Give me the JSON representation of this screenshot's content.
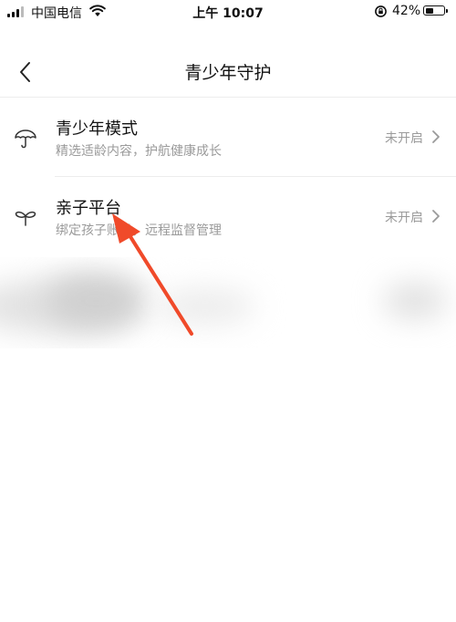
{
  "status_bar": {
    "carrier": "中国电信",
    "time": "上午 10:07",
    "battery_percent_label": "42%",
    "battery_level": 0.42,
    "icons": [
      "signal-icon",
      "wifi-icon",
      "rotation-lock-icon",
      "battery-icon"
    ]
  },
  "nav": {
    "title": "青少年守护",
    "back_icon": "chevron-left-icon"
  },
  "items": [
    {
      "title": "青少年模式",
      "subtitle": "精选适龄内容，护航健康成长",
      "status": "未开启",
      "icon": "umbrella-icon"
    },
    {
      "title": "亲子平台",
      "subtitle": "绑定孩子账号，远程监督管理",
      "status": "未开启",
      "icon": "sprout-icon"
    }
  ],
  "annotation": {
    "icon": "arrow-annotation",
    "color": "#f04a2a"
  },
  "colors": {
    "text_primary": "#111111",
    "text_secondary": "#9a9a9a",
    "divider": "#ececec",
    "annotation": "#f04a2a"
  }
}
